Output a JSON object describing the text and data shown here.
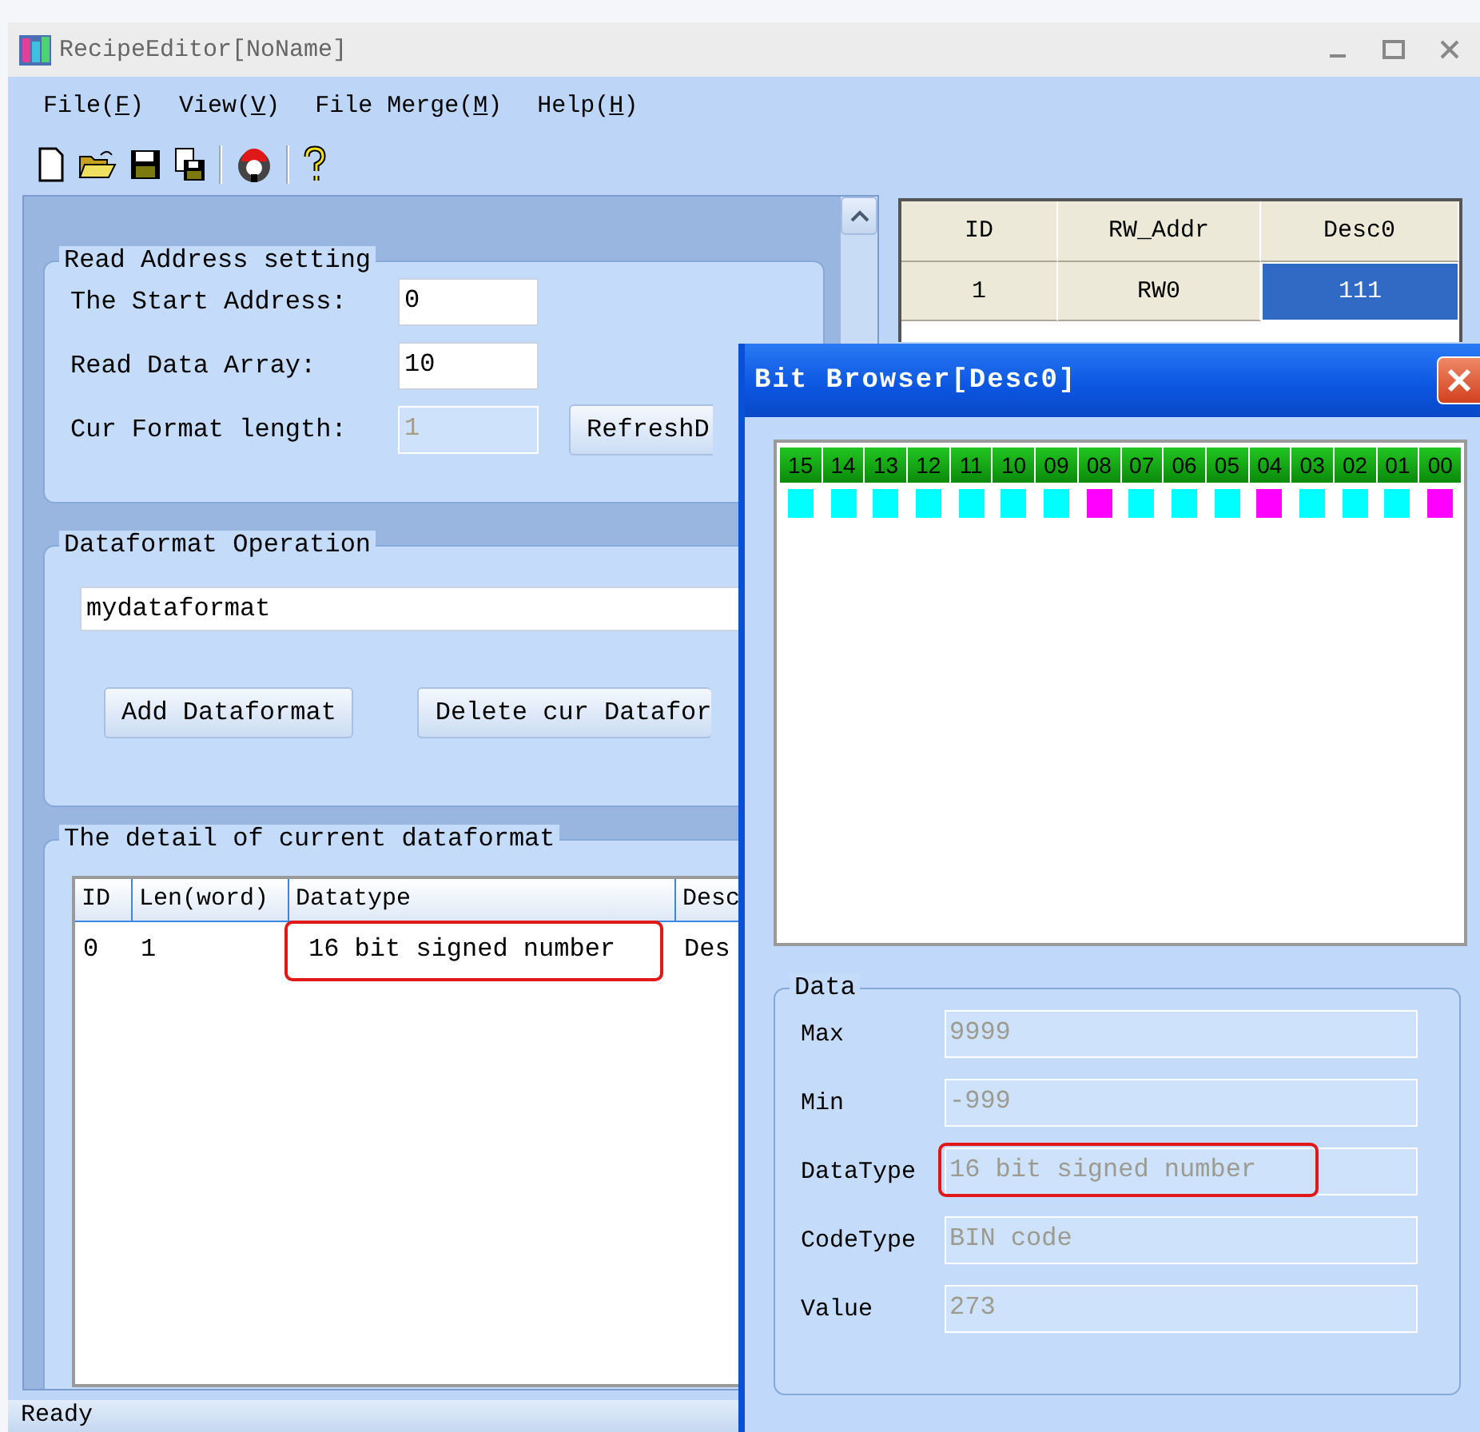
{
  "window": {
    "title": "RecipeEditor[NoName]"
  },
  "menu": [
    {
      "label": "File(F)"
    },
    {
      "label": "View(V)"
    },
    {
      "label": "File Merge(M)"
    },
    {
      "label": "Help(H)"
    }
  ],
  "read_address": {
    "title": "Read Address setting",
    "fields": [
      {
        "label": "The Start Address:",
        "value": "0",
        "disabled": false
      },
      {
        "label": "Read Data Array:",
        "value": "10",
        "disabled": false
      },
      {
        "label": "Cur Format length:",
        "value": "1",
        "disabled": true
      }
    ],
    "button": "RefreshD"
  },
  "dataformat_operation": {
    "title": "Dataformat Operation",
    "name_value": "mydataformat",
    "buttons": [
      "Add Dataformat",
      "Delete cur Datafor"
    ]
  },
  "detail": {
    "title": "The detail of current dataformat",
    "columns": [
      "ID",
      "Len(word)",
      "Datatype",
      "Desc"
    ],
    "rows": [
      {
        "cells": [
          {
            "text": "0",
            "highlighted": false
          },
          {
            "text": "1",
            "highlighted": false
          },
          {
            "text": "16 bit signed number",
            "highlighted": true
          },
          {
            "text": "Des",
            "highlighted": false
          }
        ]
      }
    ]
  },
  "status_bar": "Ready",
  "grid": {
    "columns": [
      "ID",
      "RW_Addr",
      "Desc0"
    ],
    "rows": [
      {
        "cells": [
          {
            "text": "1",
            "selected": false
          },
          {
            "text": "RW0",
            "selected": false
          },
          {
            "text": "111",
            "selected": true
          }
        ]
      }
    ]
  },
  "bit_browser": {
    "title": "Bit Browser[Desc0]",
    "bits": [
      {
        "label": "15",
        "on": false
      },
      {
        "label": "14",
        "on": false
      },
      {
        "label": "13",
        "on": false
      },
      {
        "label": "12",
        "on": false
      },
      {
        "label": "11",
        "on": false
      },
      {
        "label": "10",
        "on": false
      },
      {
        "label": "09",
        "on": false
      },
      {
        "label": "08",
        "on": true
      },
      {
        "label": "07",
        "on": false
      },
      {
        "label": "06",
        "on": false
      },
      {
        "label": "05",
        "on": false
      },
      {
        "label": "04",
        "on": true
      },
      {
        "label": "03",
        "on": false
      },
      {
        "label": "02",
        "on": false
      },
      {
        "label": "01",
        "on": false
      },
      {
        "label": "00",
        "on": true
      }
    ],
    "data": {
      "title": "Data",
      "fields": [
        {
          "label": "Max",
          "value": "9999",
          "highlighted": false,
          "disabled": true
        },
        {
          "label": "Min",
          "value": "-999",
          "highlighted": false,
          "disabled": true
        },
        {
          "label": "DataType",
          "value": "16 bit signed number",
          "highlighted": true,
          "disabled": true
        },
        {
          "label": "CodeType",
          "value": "BIN code",
          "highlighted": false,
          "disabled": true
        },
        {
          "label": "Value",
          "value": "273",
          "highlighted": false,
          "disabled": true
        }
      ]
    }
  }
}
